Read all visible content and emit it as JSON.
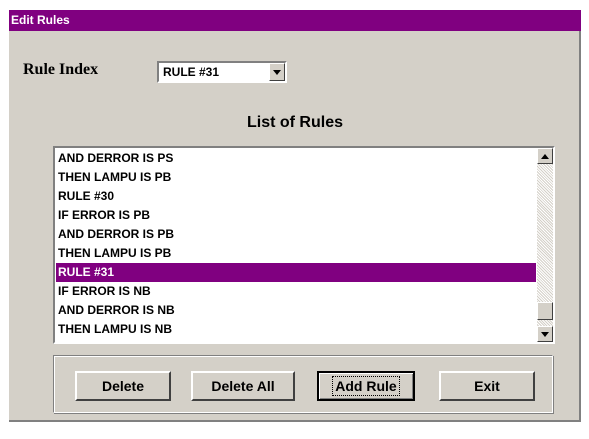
{
  "window": {
    "title": "Edit Rules"
  },
  "rule_index": {
    "label": "Rule Index",
    "selected": "RULE #31"
  },
  "list": {
    "title": "List of Rules",
    "items": [
      "AND DERROR IS PS",
      "THEN LAMPU IS PB",
      "RULE #30",
      "IF ERROR IS PB",
      "AND DERROR IS PB",
      "THEN LAMPU IS PB",
      "RULE #31",
      "IF ERROR IS NB",
      "AND DERROR IS NB",
      "THEN LAMPU IS NB"
    ],
    "selected_item": "RULE #31"
  },
  "buttons": {
    "delete": "Delete",
    "delete_all": "Delete All",
    "add_rule": "Add Rule",
    "exit": "Exit"
  },
  "colors": {
    "accent": "#800080",
    "face": "#d4d0c8"
  }
}
